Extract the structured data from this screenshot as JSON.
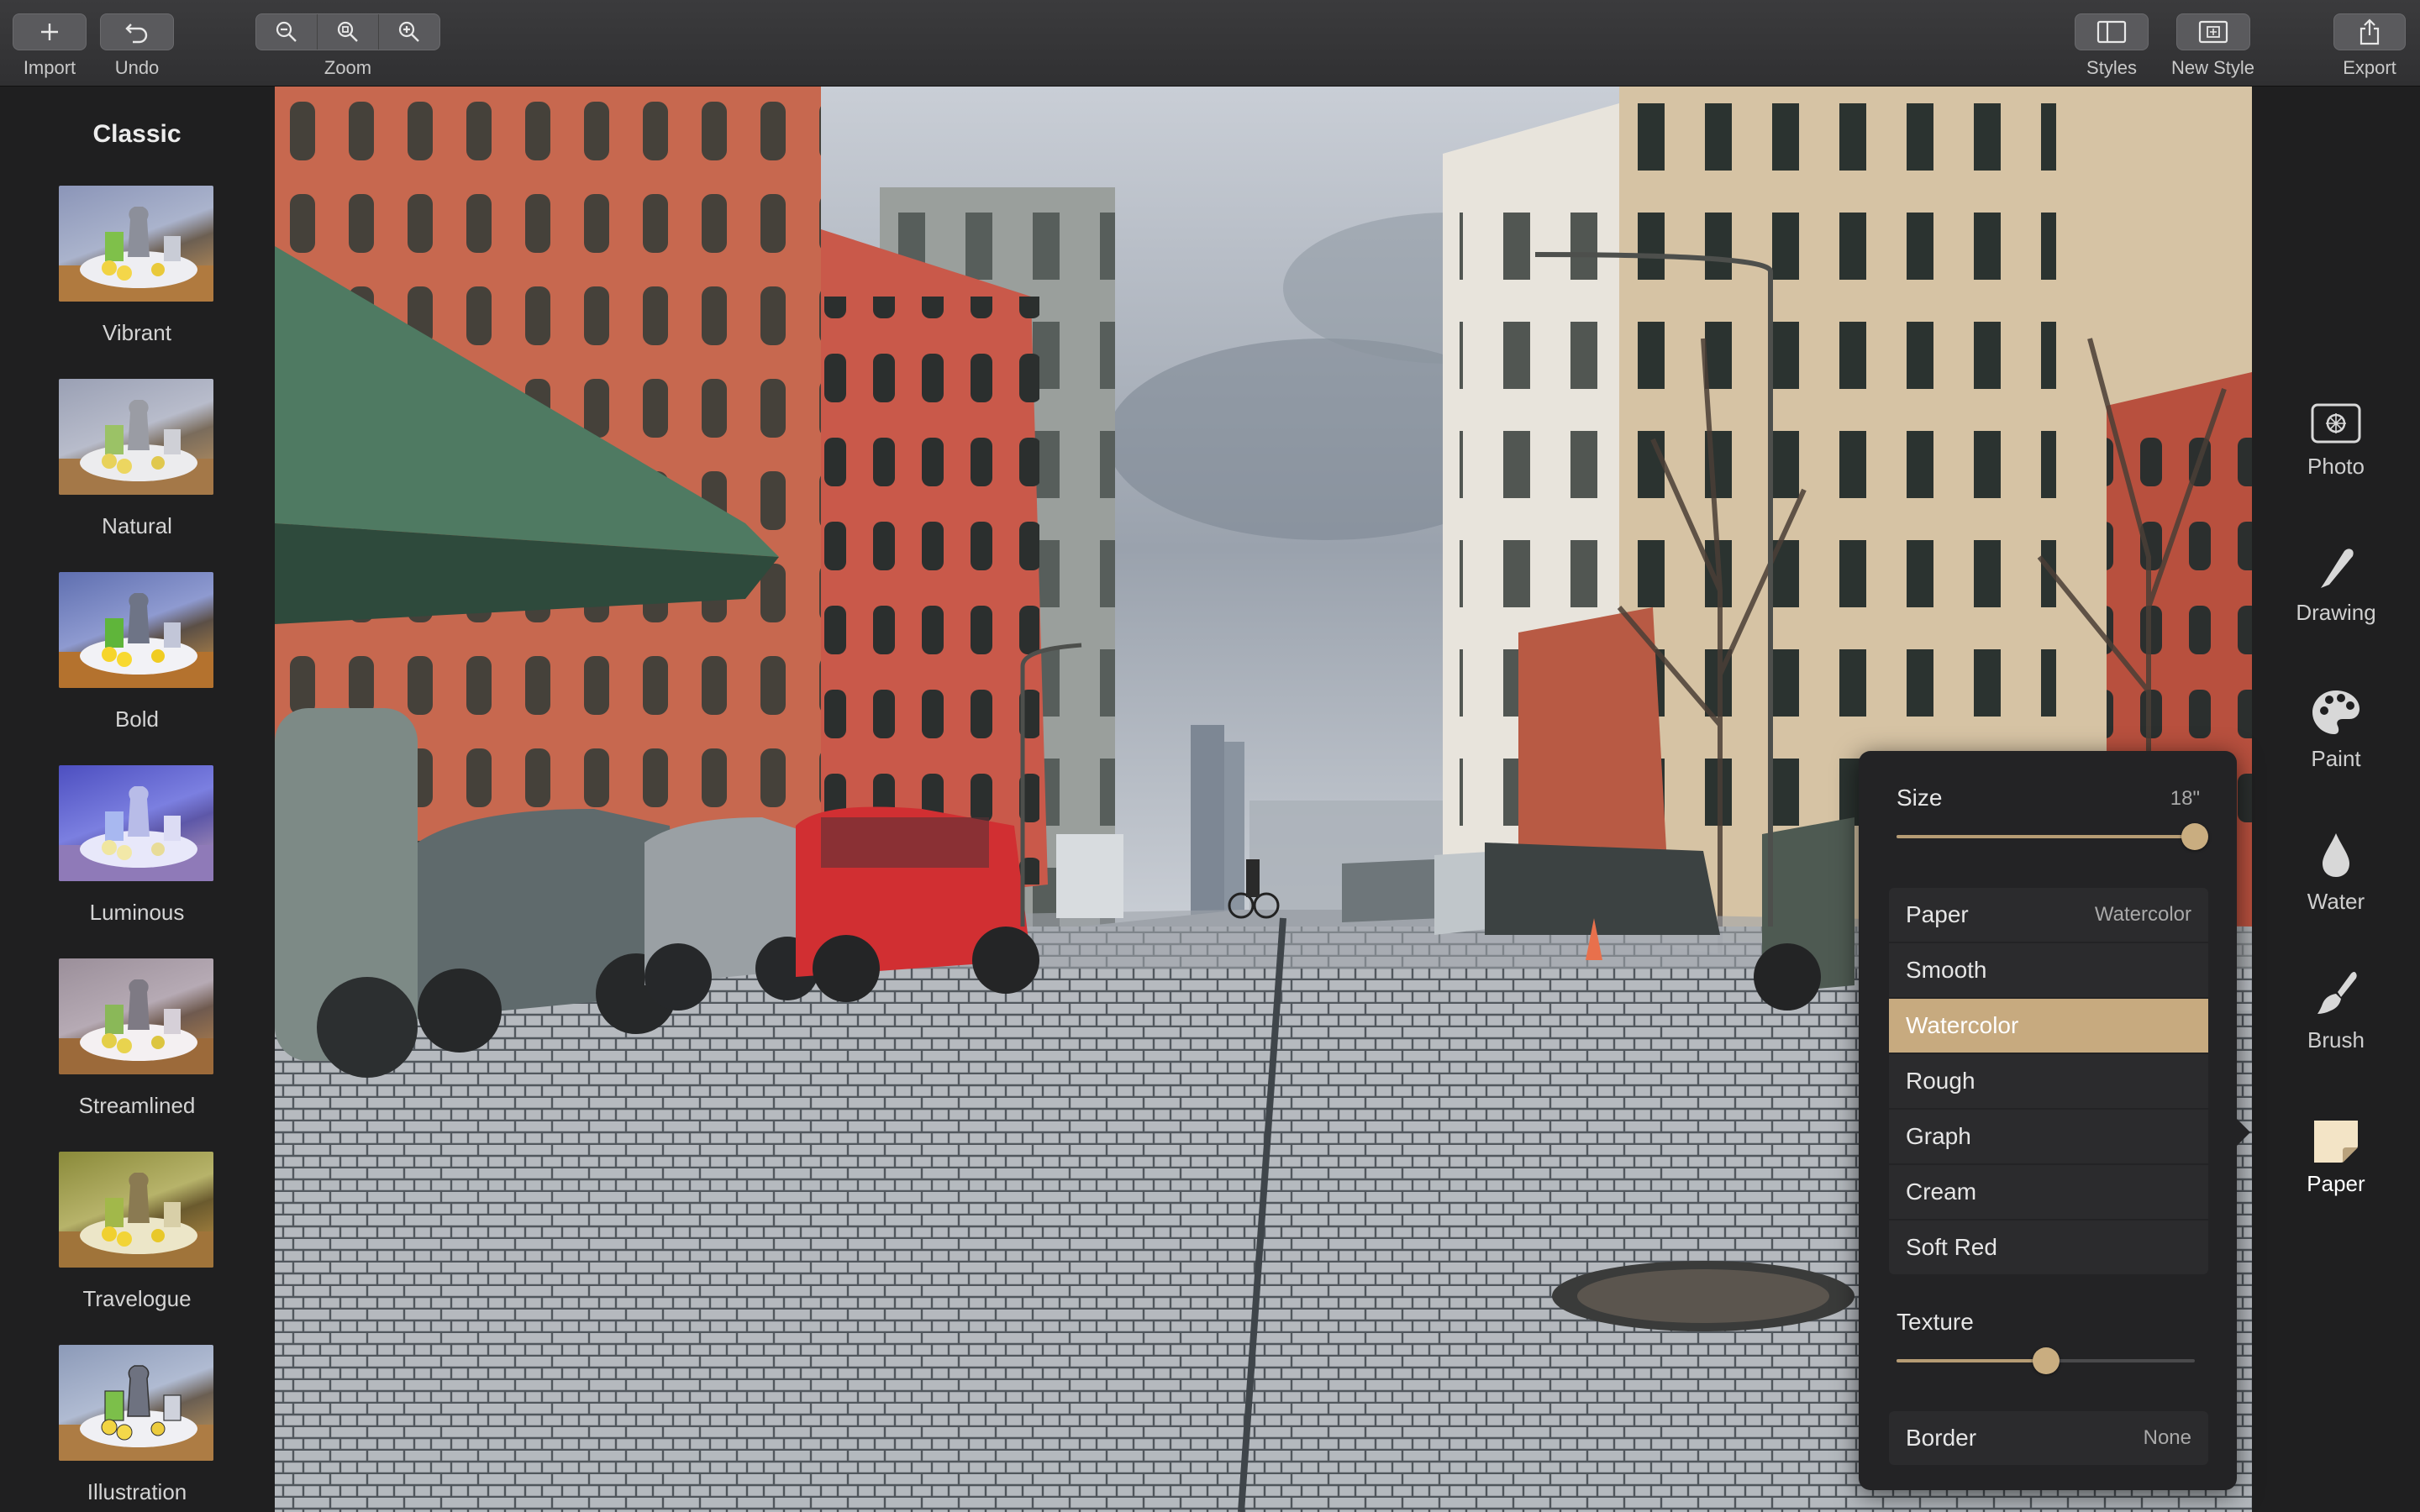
{
  "toolbar": {
    "import_label": "Import",
    "undo_label": "Undo",
    "zoom_label": "Zoom",
    "styles_label": "Styles",
    "new_style_label": "New Style",
    "export_label": "Export"
  },
  "sidebar": {
    "title": "Classic",
    "styles": [
      {
        "label": "Vibrant"
      },
      {
        "label": "Natural"
      },
      {
        "label": "Bold"
      },
      {
        "label": "Luminous"
      },
      {
        "label": "Streamlined"
      },
      {
        "label": "Travelogue"
      },
      {
        "label": "Illustration"
      }
    ]
  },
  "tools": [
    {
      "label": "Photo",
      "icon": "photo-icon"
    },
    {
      "label": "Drawing",
      "icon": "pencil-icon"
    },
    {
      "label": "Paint",
      "icon": "palette-icon"
    },
    {
      "label": "Water",
      "icon": "water-drop-icon"
    },
    {
      "label": "Brush",
      "icon": "brush-icon"
    },
    {
      "label": "Paper",
      "icon": "paper-icon"
    }
  ],
  "paper_panel": {
    "size_label": "Size",
    "size_value": "18\"",
    "size_fraction": 1.0,
    "paper_label": "Paper",
    "paper_value": "Watercolor",
    "paper_options": [
      "Smooth",
      "Watercolor",
      "Rough",
      "Graph",
      "Cream",
      "Soft Red"
    ],
    "selected_option": "Watercolor",
    "texture_label": "Texture",
    "texture_fraction": 0.5,
    "border_label": "Border",
    "border_value": "None"
  },
  "colors": {
    "accent": "#c7aa7f",
    "panel_bg": "#232325",
    "toolbar_bg": "#363638"
  }
}
